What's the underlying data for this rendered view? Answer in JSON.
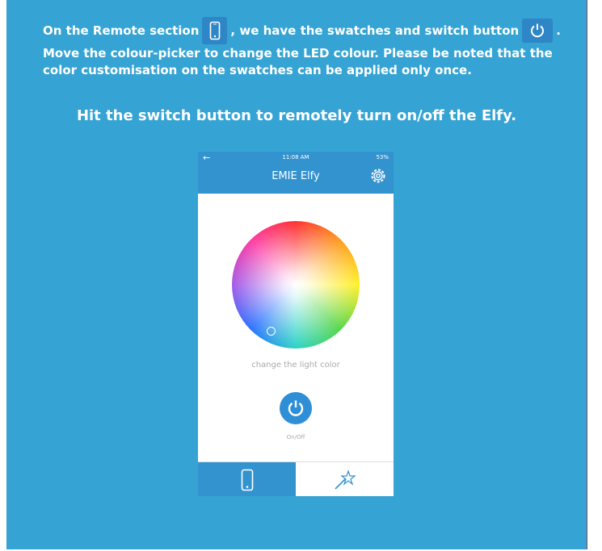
{
  "instructions": {
    "line1_a": "On the Remote section",
    "line1_b": ", we have the swatches and switch button",
    "line1_c": ".",
    "line2": "Move the colour-picker to change the LED colour. Please be noted that the color customisation on the swatches can be applied only once.",
    "heading": "Hit the switch button to remotely turn on/off the Elfy."
  },
  "app": {
    "status_time": "11:08 AM",
    "status_battery": "53%",
    "title": "EMIE Elfy",
    "caption": "change the light color",
    "onoff_label": "On/Off"
  },
  "icons": {
    "remote_inline": "phone-icon",
    "power_inline": "power-icon",
    "back": "back-arrow-icon",
    "settings": "gear-icon",
    "tab_remote": "phone-icon",
    "tab_swatches": "magic-wand-icon"
  },
  "colors": {
    "panel_background": "#35a3d4",
    "app_header": "#3393cf",
    "power_button": "#2f8fd6",
    "text": "#ffffff"
  }
}
